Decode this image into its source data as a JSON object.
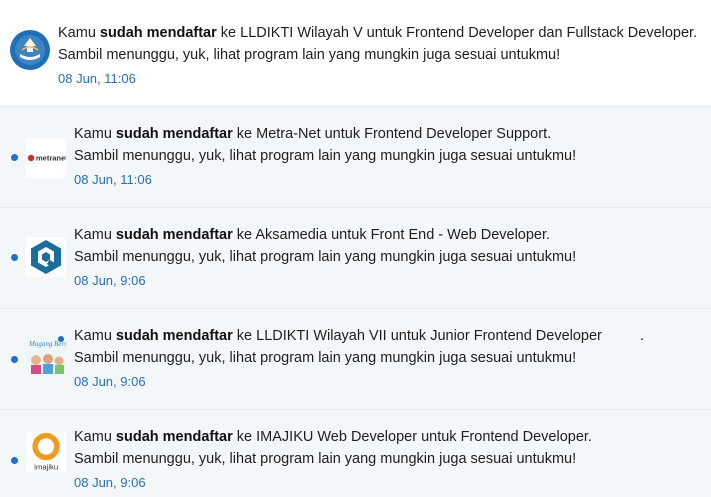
{
  "notifications": [
    {
      "read": true,
      "prefix": "Kamu ",
      "bold": "sudah mendaftar",
      "suffix": " ke LLDIKTI Wilayah V untuk Frontend Developer dan Fullstack Developer.",
      "line2": "Sambil menunggu, yuk, lihat program lain yang mungkin juga sesuai untukmu!",
      "time": "08 Jun, 11:06",
      "logo": "tut-wuri-handayani-logo"
    },
    {
      "read": false,
      "prefix": "Kamu ",
      "bold": "sudah mendaftar",
      "suffix": " ke Metra-Net untuk Frontend Developer Support.",
      "line2": "Sambil menunggu, yuk, lihat program lain yang mungkin juga sesuai untukmu!",
      "time": "08 Jun, 11:06",
      "logo": "metranet-logo",
      "logo_text": "metranet"
    },
    {
      "read": false,
      "prefix": "Kamu ",
      "bold": "sudah mendaftar",
      "suffix": " ke Aksamedia untuk Front End - Web Developer.",
      "line2": "Sambil menunggu, yuk, lihat program lain yang mungkin juga sesuai untukmu!",
      "time": "08 Jun, 9:06",
      "logo": "aksamedia-logo"
    },
    {
      "read": false,
      "prefix": "Kamu ",
      "bold": "sudah mendaftar",
      "suffix": " ke LLDIKTI Wilayah VII untuk Junior Frontend Developer",
      "suffix_tail": ".",
      "line2": "Sambil menunggu, yuk, lihat program lain yang mungkin juga sesuai untukmu!",
      "time": "08 Jun, 9:06",
      "logo": "magang-bersertifikat-logo",
      "logo_text": "Magang Bersama"
    },
    {
      "read": false,
      "prefix": "Kamu ",
      "bold": "sudah mendaftar",
      "suffix": " ke IMAJIKU Web Developer untuk Frontend Developer.",
      "line2": "Sambil menunggu, yuk, lihat program lain yang mungkin juga sesuai untukmu!",
      "time": "08 Jun, 9:06",
      "logo": "imajiku-logo",
      "logo_text": "imajiku"
    }
  ],
  "colors": {
    "unread_bg": "#f3f7fa",
    "dot": "#1f6fd1",
    "time": "#2a6fae",
    "imajiku_orange": "#f39a1e",
    "aksamedia_blue": "#1a6e9e",
    "metranet_red": "#d62b2b"
  }
}
